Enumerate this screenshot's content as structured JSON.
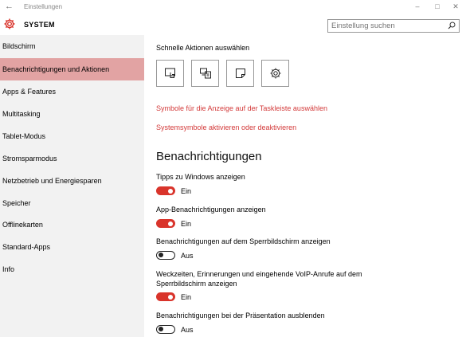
{
  "window": {
    "title": "Einstellungen",
    "back_glyph": "←",
    "minimize_glyph": "–",
    "maximize_glyph": "□",
    "close_glyph": "✕"
  },
  "header": {
    "title": "SYSTEM",
    "icon": "gear-icon",
    "accent_color": "#d9342b"
  },
  "search": {
    "placeholder": "Einstellung suchen",
    "icon": "search-icon"
  },
  "sidebar": {
    "items": [
      {
        "label": "Bildschirm",
        "active": false
      },
      {
        "label": "Benachrichtigungen und Aktionen",
        "active": true
      },
      {
        "label": "Apps & Features",
        "active": false
      },
      {
        "label": "Multitasking",
        "active": false
      },
      {
        "label": "Tablet-Modus",
        "active": false
      },
      {
        "label": "Stromsparmodus",
        "active": false
      },
      {
        "label": "Netzbetrieb und Energiesparen",
        "active": false
      },
      {
        "label": "Speicher",
        "active": false
      },
      {
        "label": "Offlinekarten",
        "active": false
      },
      {
        "label": "Standard-Apps",
        "active": false
      },
      {
        "label": "Info",
        "active": false
      }
    ]
  },
  "quick_actions": {
    "label": "Schnelle Aktionen auswählen",
    "tiles": [
      "tablet-mode-icon",
      "project-icon",
      "note-icon",
      "settings-icon"
    ]
  },
  "links": {
    "taskbar_icons": "Symbole für die Anzeige auf der Taskleiste auswählen",
    "system_icons": "Systemsymbole aktivieren oder deaktivieren"
  },
  "notifications": {
    "heading": "Benachrichtigungen",
    "settings": [
      {
        "label": "Tipps zu Windows anzeigen",
        "state": "Ein",
        "on": true
      },
      {
        "label": "App-Benachrichtigungen anzeigen",
        "state": "Ein",
        "on": true
      },
      {
        "label": "Benachrichtigungen auf dem Sperrbildschirm anzeigen",
        "state": "Aus",
        "on": false
      },
      {
        "label": "Weckzeiten, Erinnerungen und eingehende VoIP-Anrufe auf dem Sperrbildschirm anzeigen",
        "state": "Ein",
        "on": true
      },
      {
        "label": "Benachrichtigungen bei der Präsentation ausblenden",
        "state": "Aus",
        "on": false
      }
    ]
  }
}
